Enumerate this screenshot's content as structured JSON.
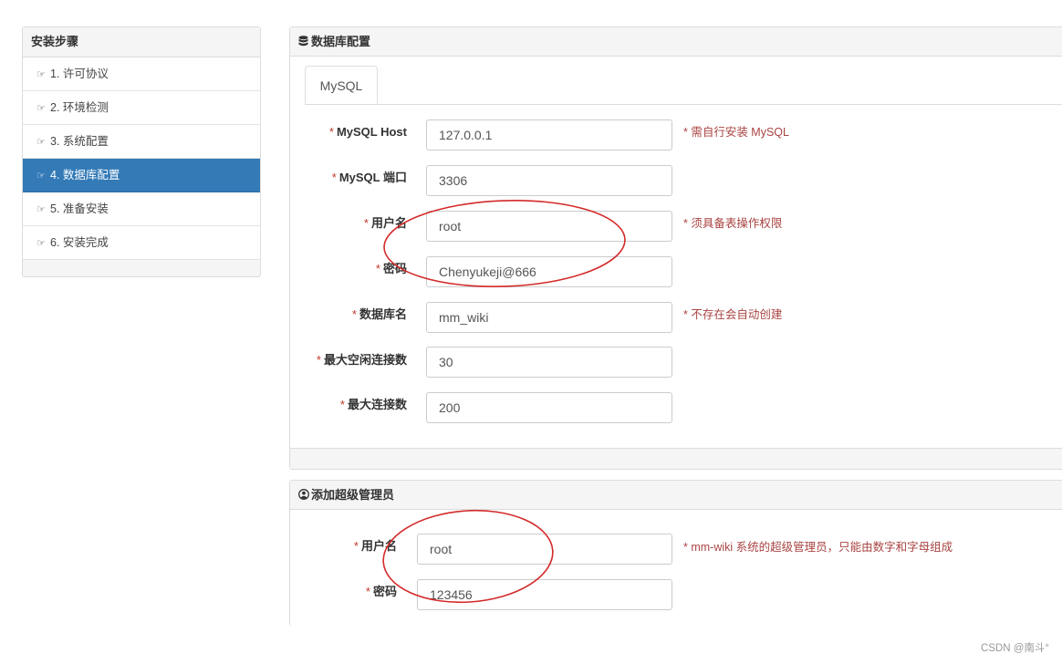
{
  "steps": {
    "title": "安装步骤",
    "hand_glyph": "☞",
    "items": [
      {
        "label": "1. 许可协议"
      },
      {
        "label": "2. 环境检测"
      },
      {
        "label": "3. 系统配置"
      },
      {
        "label": "4. 数据库配置",
        "active": true
      },
      {
        "label": "5. 准备安装"
      },
      {
        "label": "6. 安装完成"
      }
    ]
  },
  "db_panel": {
    "title": "数据库配置",
    "icon": "database-icon",
    "tab": "MySQL",
    "required_mark": "*",
    "fields": [
      {
        "label": "MySQL Host",
        "value": "127.0.0.1",
        "hint": "* 需自行安装 MySQL"
      },
      {
        "label": "MySQL 端口",
        "value": "3306",
        "hint": ""
      },
      {
        "label": "用户名",
        "value": "root",
        "hint": "* 须具备表操作权限"
      },
      {
        "label": "密码",
        "value": "Chenyukeji@666",
        "hint": ""
      },
      {
        "label": "数据库名",
        "value": "mm_wiki",
        "hint": "* 不存在会自动创建"
      },
      {
        "label": "最大空闲连接数",
        "value": "30",
        "hint": ""
      },
      {
        "label": "最大连接数",
        "value": "200",
        "hint": ""
      }
    ]
  },
  "admin_panel": {
    "title": "添加超级管理员",
    "icon": "user-circle-icon",
    "fields": [
      {
        "label": "用户名",
        "value": "root",
        "hint": "* mm-wiki 系统的超级管理员，只能由数字和字母组成"
      },
      {
        "label": "密码",
        "value": "123456",
        "hint": ""
      }
    ]
  },
  "annotation_color": "#d42a2a",
  "watermark": "CSDN @南斗°"
}
